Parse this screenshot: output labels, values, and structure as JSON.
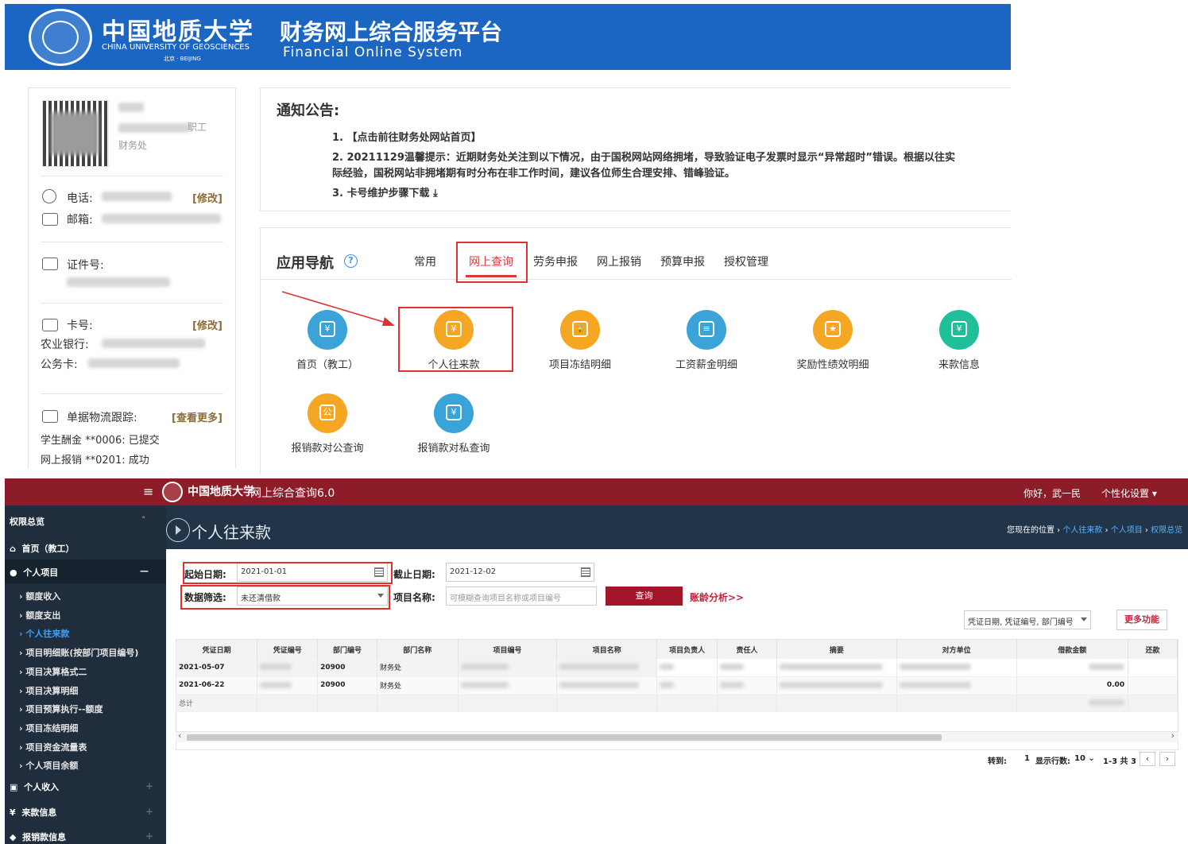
{
  "portal": {
    "univ_cn": "中国地质大学",
    "univ_en": "CHINA UNIVERSITY OF GEOSCIENCES",
    "univ_city": "北京 · BEIJING",
    "title_cn": "财务网上综合服务平台",
    "title_en": "Financial Online System"
  },
  "profile": {
    "role_suffix": "职工",
    "dept": "财务处",
    "phone_label": "电话:",
    "email_label": "邮箱:",
    "edit_label": "[修改]",
    "id_label": "证件号:",
    "card_label": "卡号:",
    "bank_label": "农业银行:",
    "gongwu_label": "公务卡:",
    "track_label": "单据物流跟踪:",
    "more_label": "[查看更多]",
    "track_items": [
      "学生酬金 **0006: 已提交",
      "网上报销 **0201: 成功"
    ]
  },
  "notice": {
    "title": "通知公告:",
    "item1": "1. 【点击前往财务处网站首页】",
    "item2_line1": "2. 20211129温馨提示：近期财务处关注到以下情况，由于国税网站网络拥堵，导致验证电子发票时显示“异常超时”错误。根据以往实",
    "item2_line2": "际经验，国税网站非拥堵期有时分布在非工作时间，建议各位师生合理安排、错峰验证。",
    "item3": "3. 卡号维护步骤下载"
  },
  "appnav": {
    "title": "应用导航",
    "help_icon": "question-circle-icon",
    "tabs": [
      "常用",
      "网上查询",
      "劳务申报",
      "网上报销",
      "预算申报",
      "授权管理"
    ],
    "active_tab": "网上查询",
    "apps": [
      {
        "label": "首页（教工）",
        "color": "#3aa3d8",
        "icon": "yuan-ticket-icon",
        "glyph": "¥"
      },
      {
        "label": "个人往来款",
        "color": "#f5a623",
        "icon": "money-bag-icon",
        "glyph": "¥"
      },
      {
        "label": "项目冻结明细",
        "color": "#f5a623",
        "icon": "lock-icon",
        "glyph": "🔒"
      },
      {
        "label": "工资薪金明细",
        "color": "#3aa3d8",
        "icon": "payslip-icon",
        "glyph": "≡"
      },
      {
        "label": "奖励性绩效明细",
        "color": "#f5a623",
        "icon": "award-icon",
        "glyph": "★"
      },
      {
        "label": "来款信息",
        "color": "#1fbf9a",
        "icon": "incoming-money-icon",
        "glyph": "¥"
      },
      {
        "label": "报销款对公查询",
        "color": "#f5a623",
        "icon": "public-reimburse-icon",
        "glyph": "公"
      },
      {
        "label": "报销款对私查询",
        "color": "#3aa3d8",
        "icon": "private-reimburse-icon",
        "glyph": "¥"
      }
    ]
  },
  "query_app": {
    "title": "网上综合查询6.0",
    "greeting": "你好，武一民",
    "settings": "个性化设置 ▾",
    "page_title": "个人往来款",
    "breadcrumb_prefix": "您现在的位置 › ",
    "breadcrumb_links": [
      "个人往来款",
      "个人项目",
      "权限总览"
    ],
    "sidebar": {
      "overview": "权限总览",
      "home": "首页（教工）",
      "personal_project": "个人项目",
      "sub_items": [
        "额度收入",
        "额度支出",
        "个人往来款",
        "项目明细账(按部门项目编号)",
        "项目决算格式二",
        "项目决算明细",
        "项目预算执行--额度",
        "项目冻结明细",
        "项目资金流量表",
        "个人项目余额"
      ],
      "active_sub": "个人往来款",
      "personal_income": "个人收入",
      "incoming": "来款信息",
      "reimburse": "报销款信息"
    },
    "form": {
      "start_label": "起始日期:",
      "start_value": "2021-01-01",
      "end_label": "截止日期:",
      "end_value": "2021-12-02",
      "filter_label": "数据筛选:",
      "filter_value": "未还清借款",
      "project_label": "项目名称:",
      "project_placeholder": "可模糊查询项目名称或项目编号",
      "query_button": "查询",
      "aging_link": "账龄分析>>",
      "sort_select": "凭证日期, 凭证编号, 部门编号",
      "more_button": "更多功能"
    },
    "table": {
      "headers": [
        "凭证日期",
        "凭证编号",
        "部门编号",
        "部门名称",
        "项目编号",
        "项目名称",
        "项目负责人",
        "责任人",
        "摘要",
        "对方单位",
        "借款金额",
        "还款"
      ],
      "rows": [
        {
          "date": "2021-05-07",
          "dept_no": "20900",
          "dept_name": "财务处",
          "amount": ""
        },
        {
          "date": "2021-06-22",
          "dept_no": "20900",
          "dept_name": "财务处",
          "amount": "0.00"
        }
      ],
      "total_label": "总计"
    },
    "pager": {
      "goto_label": "转到:",
      "goto_value": "1",
      "rows_label": "显示行数:",
      "rows_value": "10 ⌄",
      "range": "1-3 共 3",
      "prev": "‹",
      "next": "›"
    }
  }
}
